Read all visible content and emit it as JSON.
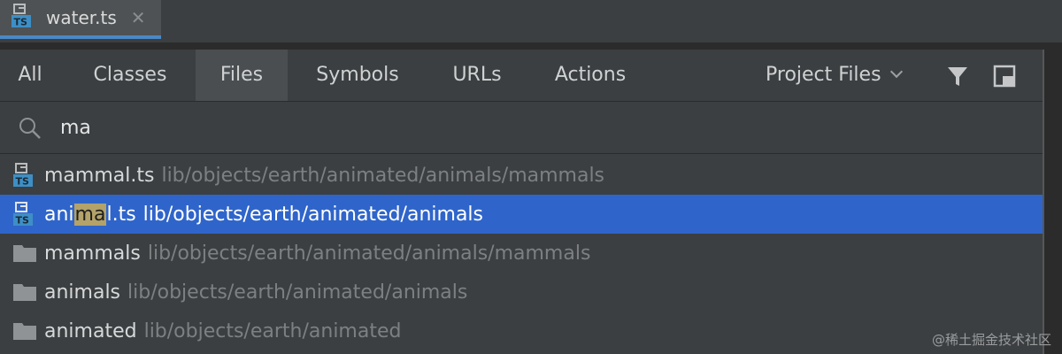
{
  "editor": {
    "tab_label": "water.ts",
    "close_glyph": "✕"
  },
  "popup": {
    "tabs": [
      {
        "label": "All"
      },
      {
        "label": "Classes"
      },
      {
        "label": "Files",
        "selected": true
      },
      {
        "label": "Symbols"
      },
      {
        "label": "URLs"
      },
      {
        "label": "Actions"
      }
    ],
    "scope": "Project Files",
    "search": {
      "value": "ma",
      "icon": "search-icon"
    },
    "results": [
      {
        "icon": "typescript-file-icon",
        "name": "mammal.ts",
        "path": "lib/objects/earth/animated/animals/mammals"
      },
      {
        "icon": "typescript-file-icon",
        "name": "animal.ts",
        "name_pre": "ani",
        "name_match": "ma",
        "name_post": "l.ts",
        "path": "lib/objects/earth/animated/animals",
        "selected": true
      },
      {
        "icon": "folder-icon",
        "name": "mammals",
        "path": "lib/objects/earth/animated/animals/mammals"
      },
      {
        "icon": "folder-icon",
        "name": "animals",
        "path": "lib/objects/earth/animated/animals"
      },
      {
        "icon": "folder-icon",
        "name": "animated",
        "path": "lib/objects/earth/animated"
      }
    ]
  },
  "watermark": "@稀土掘金技术社区",
  "colors": {
    "selection": "#2f65ca",
    "match_highlight": "#b3a36a",
    "accent": "#4a88c7"
  }
}
